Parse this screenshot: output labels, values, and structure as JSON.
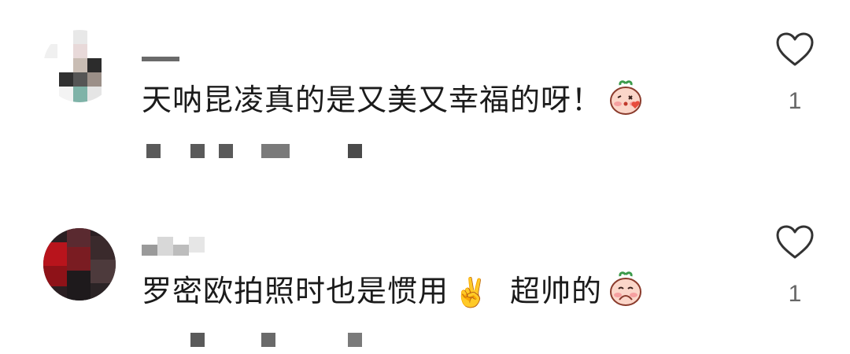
{
  "comments": [
    {
      "text": "天呐昆凌真的是又美又幸福的呀！",
      "emoji_icon": "peach-kiss-emoji",
      "like_count": "1"
    },
    {
      "text": "罗密欧拍照时也是惯用",
      "hand_emoji": "✌️",
      "text_suffix": "超帅的",
      "emoji_icon": "peach-hiding-emoji",
      "like_count": "1"
    }
  ],
  "colors": {
    "text": "#1b1b1b",
    "like_count": "#666666",
    "heart_stroke": "#333333",
    "blur_gray": "#555555"
  }
}
